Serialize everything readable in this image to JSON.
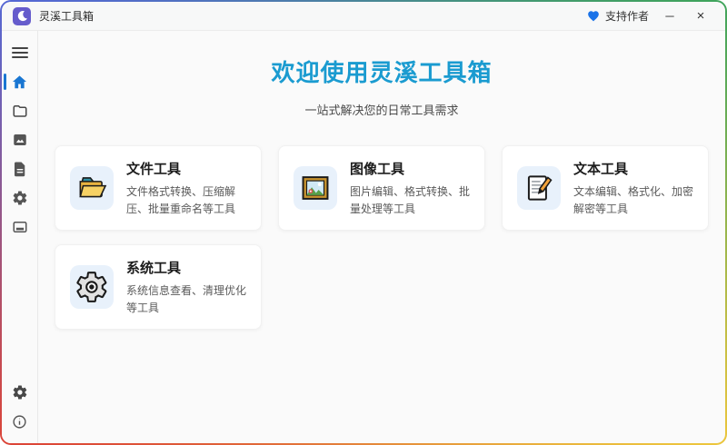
{
  "titlebar": {
    "title": "灵溪工具箱",
    "support_label": "支持作者",
    "minimize_glyph": "─",
    "close_glyph": "×"
  },
  "sidebar": {
    "active_item": "home",
    "top_icons": [
      "menu-icon",
      "home-icon",
      "folder-icon",
      "image-icon",
      "document-icon",
      "gear-icon",
      "panel-icon"
    ],
    "bottom_icons": [
      "settings-icon",
      "info-icon"
    ]
  },
  "main": {
    "heading": "欢迎使用灵溪工具箱",
    "subheading": "一站式解决您的日常工具需求",
    "cards": [
      {
        "icon": "open-folder-icon",
        "title": "文件工具",
        "description": "文件格式转换、压缩解压、批量重命名等工具"
      },
      {
        "icon": "framed-picture-icon",
        "title": "图像工具",
        "description": "图片编辑、格式转换、批量处理等工具"
      },
      {
        "icon": "memo-pencil-icon",
        "title": "文本工具",
        "description": "文本编辑、格式化、加密解密等工具"
      },
      {
        "icon": "gear-icon",
        "title": "系统工具",
        "description": "系统信息查看、清理优化等工具"
      }
    ]
  },
  "colors": {
    "heading": "#1a9bd0",
    "active_sidebar": "#1976d2",
    "heart": "#1a73e8",
    "card_icon_bg": "#e8f1fb",
    "app_icon_bg": "#655ccc",
    "border_gradient_corners": [
      "#5468d4",
      "#3fa45c",
      "#ecc63d",
      "#dc4437"
    ]
  }
}
